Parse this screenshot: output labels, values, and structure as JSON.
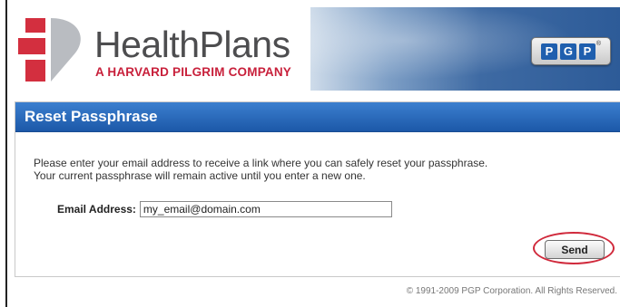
{
  "header": {
    "logo_title": "HealthPlans",
    "logo_tagline": "A HARVARD PILGRIM COMPANY",
    "badge_letters": [
      "P",
      "G",
      "P"
    ],
    "badge_reg": "®"
  },
  "panel": {
    "title": "Reset Passphrase",
    "instruction_line1": "Please enter your email address to receive a link where you can safely reset your passphrase.",
    "instruction_line2": "Your current passphrase will remain active until you enter a new one.",
    "email_label": "Email Address:",
    "email_value": "my_email@domain.com",
    "send_label": "Send"
  },
  "footer": {
    "copyright": "© 1991-2009 PGP Corporation. All Rights Reserved."
  },
  "colors": {
    "brand_red": "#c8203b",
    "title_blue": "#1c58a8",
    "highlight_circle": "#d0293b"
  }
}
